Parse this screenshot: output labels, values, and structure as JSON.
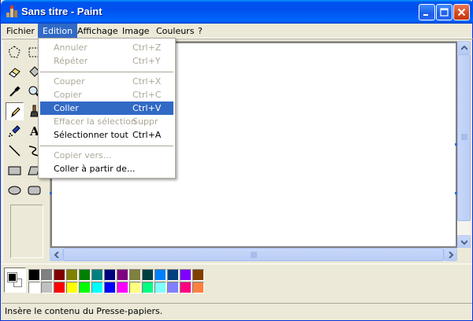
{
  "window": {
    "title": "Sans titre - Paint"
  },
  "menubar": {
    "items": [
      {
        "label": "Fichier"
      },
      {
        "label": "Edition"
      },
      {
        "label": "Affichage"
      },
      {
        "label": "Image"
      },
      {
        "label": "Couleurs"
      },
      {
        "label": "?"
      }
    ],
    "active_index": 1
  },
  "edit_menu": {
    "items": [
      {
        "label": "Annuler",
        "shortcut": "Ctrl+Z",
        "enabled": false
      },
      {
        "label": "Répéter",
        "shortcut": "Ctrl+Y",
        "enabled": false
      },
      {
        "label": "Couper",
        "shortcut": "Ctrl+X",
        "enabled": false
      },
      {
        "label": "Copier",
        "shortcut": "Ctrl+C",
        "enabled": false
      },
      {
        "label": "Coller",
        "shortcut": "Ctrl+V",
        "enabled": true,
        "highlighted": true
      },
      {
        "label": "Effacer la sélection",
        "shortcut": "Suppr",
        "enabled": false
      },
      {
        "label": "Sélectionner tout",
        "shortcut": "Ctrl+A",
        "enabled": true
      },
      {
        "label": "Copier vers...",
        "shortcut": "",
        "enabled": false
      },
      {
        "label": "Coller à partir de...",
        "shortcut": "",
        "enabled": true
      }
    ]
  },
  "toolbox": {
    "tools": [
      {
        "icon": "free-form-select-icon"
      },
      {
        "icon": "rect-select-icon"
      },
      {
        "icon": "eraser-icon"
      },
      {
        "icon": "fill-bucket-icon"
      },
      {
        "icon": "color-picker-icon"
      },
      {
        "icon": "magnifier-icon"
      },
      {
        "icon": "pencil-icon",
        "pressed": true
      },
      {
        "icon": "brush-icon"
      },
      {
        "icon": "airbrush-icon"
      },
      {
        "icon": "text-icon",
        "glyph": "A"
      },
      {
        "icon": "line-icon"
      },
      {
        "icon": "curve-icon"
      },
      {
        "icon": "rectangle-icon"
      },
      {
        "icon": "polygon-icon"
      },
      {
        "icon": "ellipse-icon"
      },
      {
        "icon": "rounded-rect-icon"
      }
    ]
  },
  "colors": {
    "foreground": "#000000",
    "background": "#FFFFFF",
    "palette_top": [
      "#000000",
      "#808080",
      "#800000",
      "#808000",
      "#008000",
      "#008080",
      "#000080",
      "#800080",
      "#808040",
      "#004040",
      "#0080FF",
      "#004080",
      "#8000FF",
      "#804000"
    ],
    "palette_bottom": [
      "#FFFFFF",
      "#C0C0C0",
      "#FF0000",
      "#FFFF00",
      "#00FF00",
      "#00FFFF",
      "#0000FF",
      "#FF00FF",
      "#FFFF80",
      "#00FF80",
      "#80FFFF",
      "#8080FF",
      "#FF0080",
      "#FF8040"
    ],
    "accent": "#316AC5",
    "titlebar": "#0054E3"
  },
  "statusbar": {
    "text": "Insère le contenu du Presse-papiers."
  }
}
